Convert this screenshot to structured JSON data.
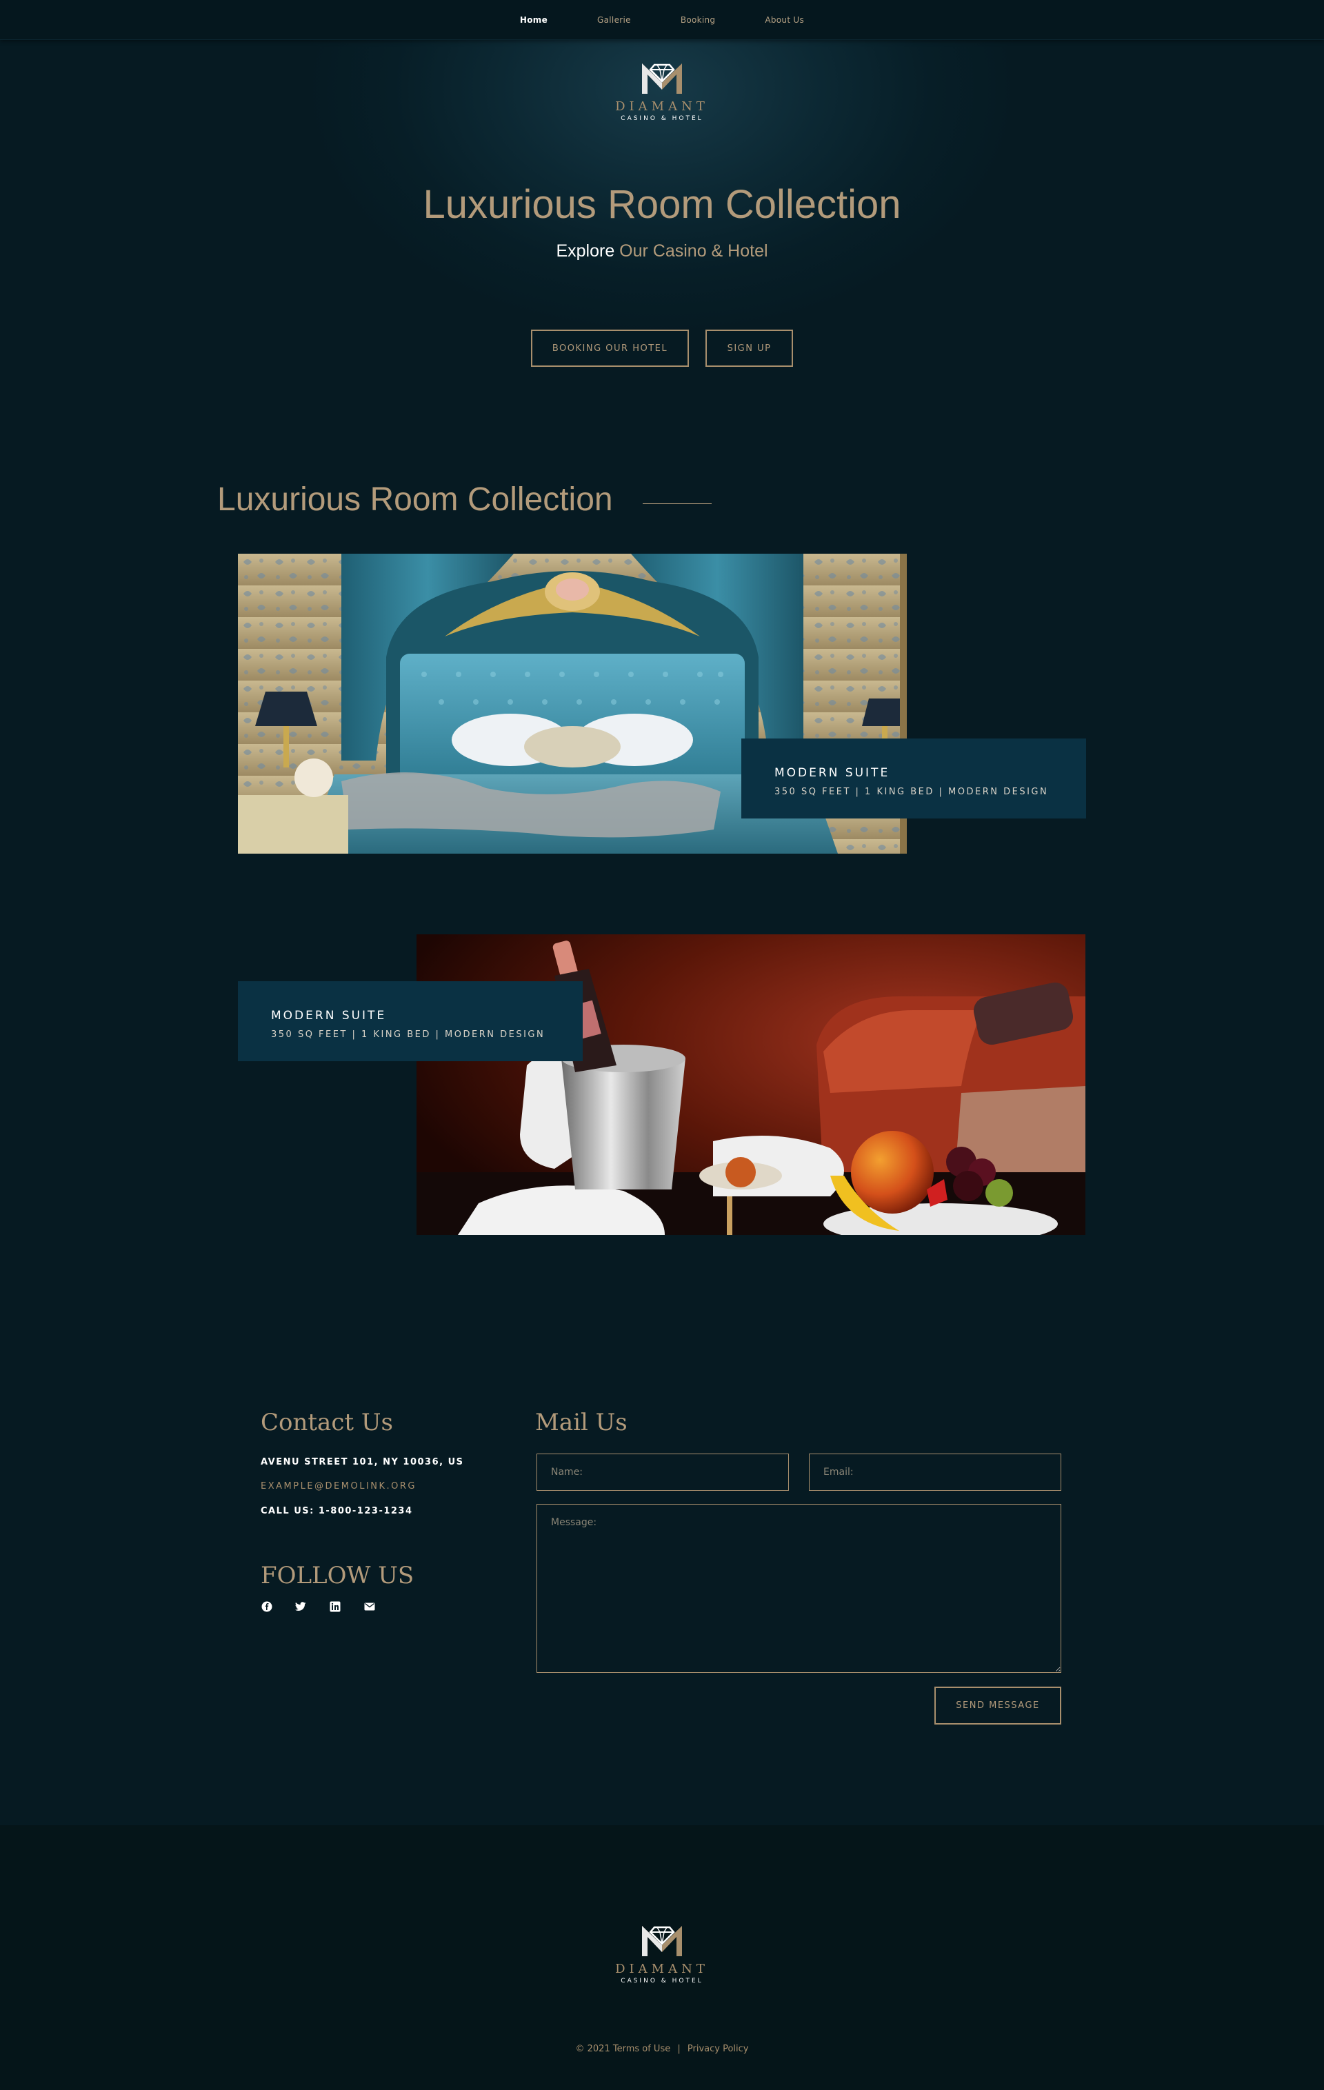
{
  "nav": {
    "items": [
      {
        "label": "Home",
        "active": true
      },
      {
        "label": "Gallerie",
        "active": false
      },
      {
        "label": "Booking",
        "active": false
      },
      {
        "label": "About Us",
        "active": false
      }
    ]
  },
  "brand": {
    "name": "DIAMANT",
    "tagline": "CASINO & HOTEL"
  },
  "hero": {
    "title": "Luxurious Room Collection",
    "subtitle_white": "Explore",
    "subtitle_gold": "Our Casino & Hotel",
    "booking_button": "BOOKING OUR HOTEL",
    "signup_button": "SIGN UP"
  },
  "rooms": {
    "title": "Luxurious Room Collection",
    "items": [
      {
        "name": "MODERN SUITE",
        "details": "350 SQ FEET | 1 KING BED | MODERN DESIGN"
      },
      {
        "name": "MODERN SUITE",
        "details": "350 SQ FEET | 1 KING BED | MODERN DESIGN"
      }
    ]
  },
  "contact": {
    "title": "Contact Us",
    "address": "AVENU STREET 101, NY 10036, US",
    "email": "EXAMPLE@DEMOLINK.ORG",
    "phone": "CALL US: 1-800-123-1234",
    "follow_title": "FOLLOW US",
    "social_icons": [
      "facebook-icon",
      "twitter-icon",
      "linkedin-icon",
      "email-icon"
    ]
  },
  "mail": {
    "title": "Mail Us",
    "name_placeholder": "Name:",
    "email_placeholder": "Email:",
    "message_placeholder": "Message:",
    "send_button": "SEND MESSAGE"
  },
  "footer": {
    "copyright": "© 2021 Terms of Use",
    "separator": "|",
    "privacy": "Privacy Policy"
  },
  "colors": {
    "background": "#061a22",
    "gold": "#b39b7b",
    "card": "#0a3143"
  }
}
